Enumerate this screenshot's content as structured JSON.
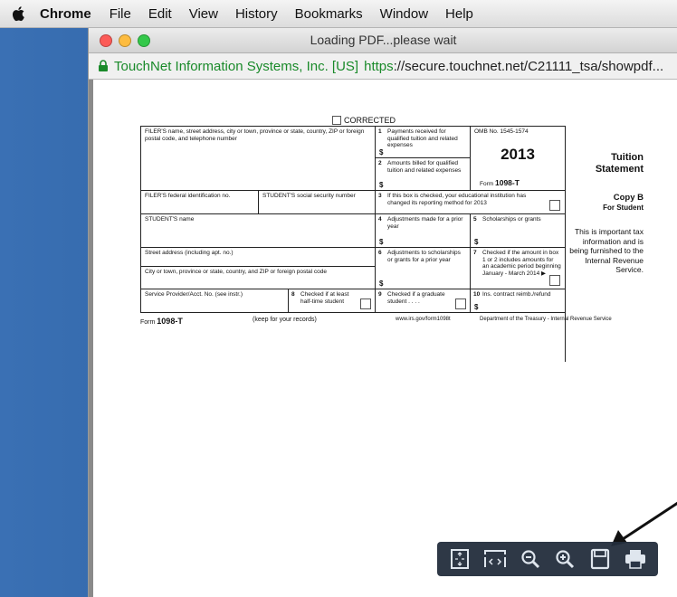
{
  "menubar": {
    "app_name": "Chrome",
    "items": [
      "File",
      "Edit",
      "View",
      "History",
      "Bookmarks",
      "Window",
      "Help"
    ]
  },
  "window": {
    "title": "Loading PDF...please wait",
    "url_identity": "TouchNet Information Systems, Inc. [US]",
    "url_scheme": "https",
    "url_rest": "://secure.touchnet.net/C21111_tsa/showpdf..."
  },
  "form": {
    "corrected_label": "CORRECTED",
    "filer_label": "FILER'S name, street address, city or town, province or state, country, ZIP or foreign postal code, and telephone number",
    "box1_label": "Payments received for qualified tuition and related expenses",
    "box2_label": "Amounts billed for qualified tuition and related expenses",
    "omb": "OMB No. 1545-1574",
    "year": "2013",
    "form_name_prefix": "Form",
    "form_name": "1098-T",
    "title_line1": "Tuition",
    "title_line2": "Statement",
    "filer_fed_id_label": "FILER'S federal identification no.",
    "student_ssn_label": "STUDENT'S social security number",
    "box3_label": "If this box is checked, your educational institution has changed its reporting method for 2013",
    "copy_label": "Copy B",
    "for_student": "For Student",
    "student_name_label": "STUDENT'S name",
    "box4_label": "Adjustments made for a prior year",
    "box5_label": "Scholarships or grants",
    "important_text": "This is important tax information and is being furnished to the Internal Revenue Service.",
    "street_label": "Street address (including apt. no.)",
    "box6_label": "Adjustments to scholarships or grants for a prior year",
    "box7_label": "Checked if the amount in box 1 or 2 includes amounts for an academic period beginning January - March 2014 ▶",
    "city_label": "City or town, province or state, country, and ZIP or foreign postal code",
    "provider_label": "Service Provider/Acct. No. (see instr.)",
    "box8_label": "Checked if at least half-time student",
    "box9_label": "Checked if a graduate student . . . .",
    "box10_label": "Ins. contract reimb./refund",
    "dollar": "$",
    "footer_form": "1098-T",
    "footer_keep": "(keep for your records)",
    "footer_url": "www.irs.gov/form1098t",
    "footer_dept": "Department of the Treasury - Internal Revenue Service",
    "num1": "1",
    "num2": "2",
    "num3": "3",
    "num4": "4",
    "num5": "5",
    "num6": "6",
    "num7": "7",
    "num8": "8",
    "num9": "9",
    "num10": "10"
  },
  "toolbar": {
    "buttons": [
      "fit-page-icon",
      "fit-width-icon",
      "zoom-out-icon",
      "zoom-in-icon",
      "save-icon",
      "print-icon"
    ]
  }
}
